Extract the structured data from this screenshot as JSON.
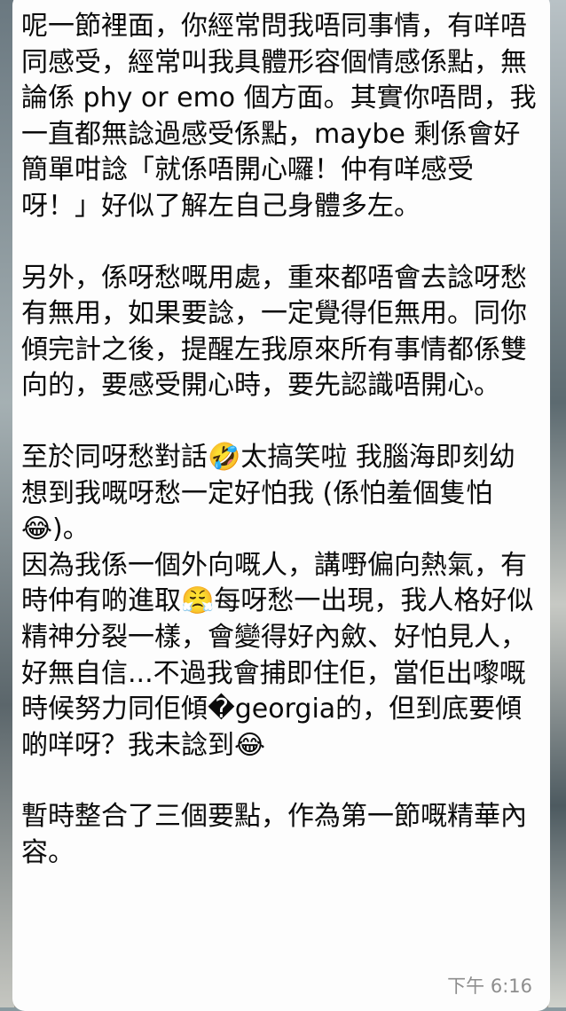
{
  "message": {
    "paragraphs": [
      "呢一節裡面，你經常問我唔同事情，有咩唔同感受，經常叫我具體形容個情感係點，無論係 phy or emo 個方面。其實你唔問，我一直都無諗過感受係點，maybe 剩係會好簡單咁諗「就係唔開心囉！仲有咩感受呀！」好似了解左自己身體多左。",
      "另外，係呀愁嘅用處，重來都唔會去諗呀愁有無用，如果要諗，一定覺得佢無用。同你傾完計之後，提醒左我原來所有事情都係雙向的，要感受開心時，要先認識唔開心。",
      "至於同呀愁對話🤣太搞笑啦 我腦海即刻幼想到我嘅呀愁一定好怕我 (係怕羞個隻怕😂)。\n因為我係一個外向嘅人，講嘢偏向熱氣，有時仲有啲進取😤每呀愁一出現，我人格好似精神分裂一樣，會變得好內斂、好怕見人，好無自信...不過我會捕即住佢，當佢出嚟嘅時候努力同佢傾�georgia的，但到底要傾啲咩呀？我未諗到😂",
      "暫時整合了三個要點，作為第一節嘅精華內容。"
    ],
    "timestamp": "下午 6:16"
  }
}
